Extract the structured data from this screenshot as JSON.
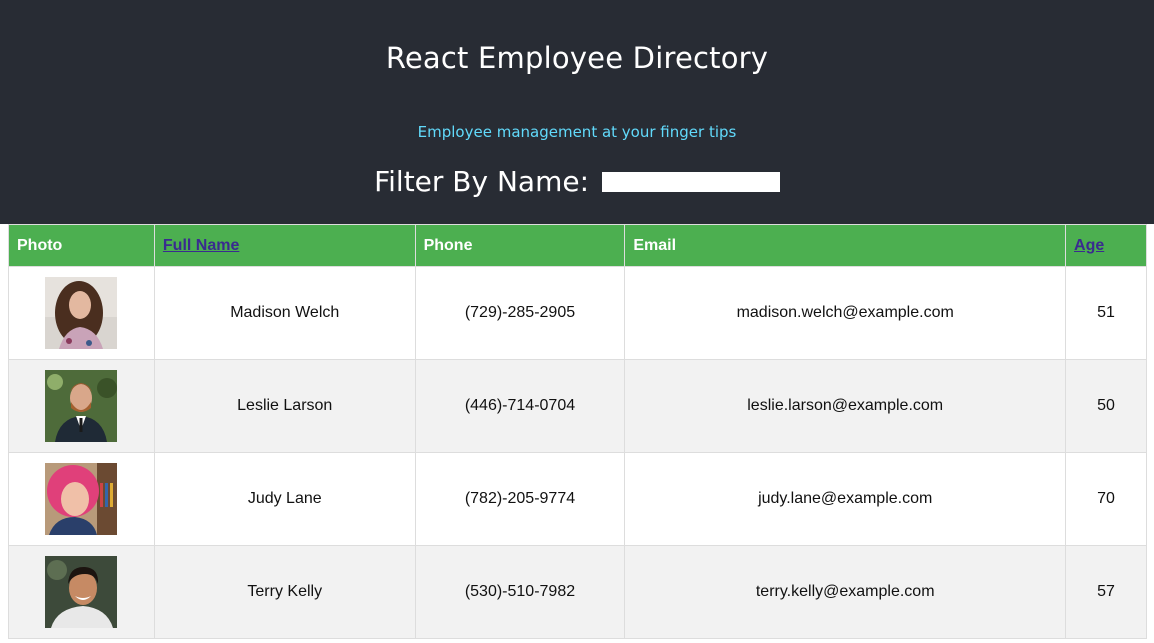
{
  "header": {
    "title": "React Employee Directory",
    "tagline": "Employee management at your finger tips",
    "filter_label": "Filter By Name:",
    "filter_value": ""
  },
  "table": {
    "columns": [
      "Photo",
      "Full Name",
      "Phone",
      "Email",
      "Age"
    ],
    "sortable_columns": [
      "Full Name",
      "Age"
    ],
    "rows": [
      {
        "name": "Madison Welch",
        "phone": "(729)-285-2905",
        "email": "madison.welch@example.com",
        "age": "51",
        "photo": "woman-curly-brown-hair"
      },
      {
        "name": "Leslie Larson",
        "phone": "(446)-714-0704",
        "email": "leslie.larson@example.com",
        "age": "50",
        "photo": "man-beard-suit"
      },
      {
        "name": "Judy Lane",
        "phone": "(782)-205-9774",
        "email": "judy.lane@example.com",
        "age": "70",
        "photo": "woman-pink-hair"
      },
      {
        "name": "Terry Kelly",
        "phone": "(530)-510-7982",
        "email": "terry.kelly@example.com",
        "age": "57",
        "photo": "man-dark-hair-smiling"
      }
    ]
  },
  "colors": {
    "header_bg": "#282c34",
    "accent_text": "#61dafb",
    "table_header_bg": "#4caf50",
    "link": "#3a2b8f",
    "row_alt_bg": "#f2f2f2"
  }
}
